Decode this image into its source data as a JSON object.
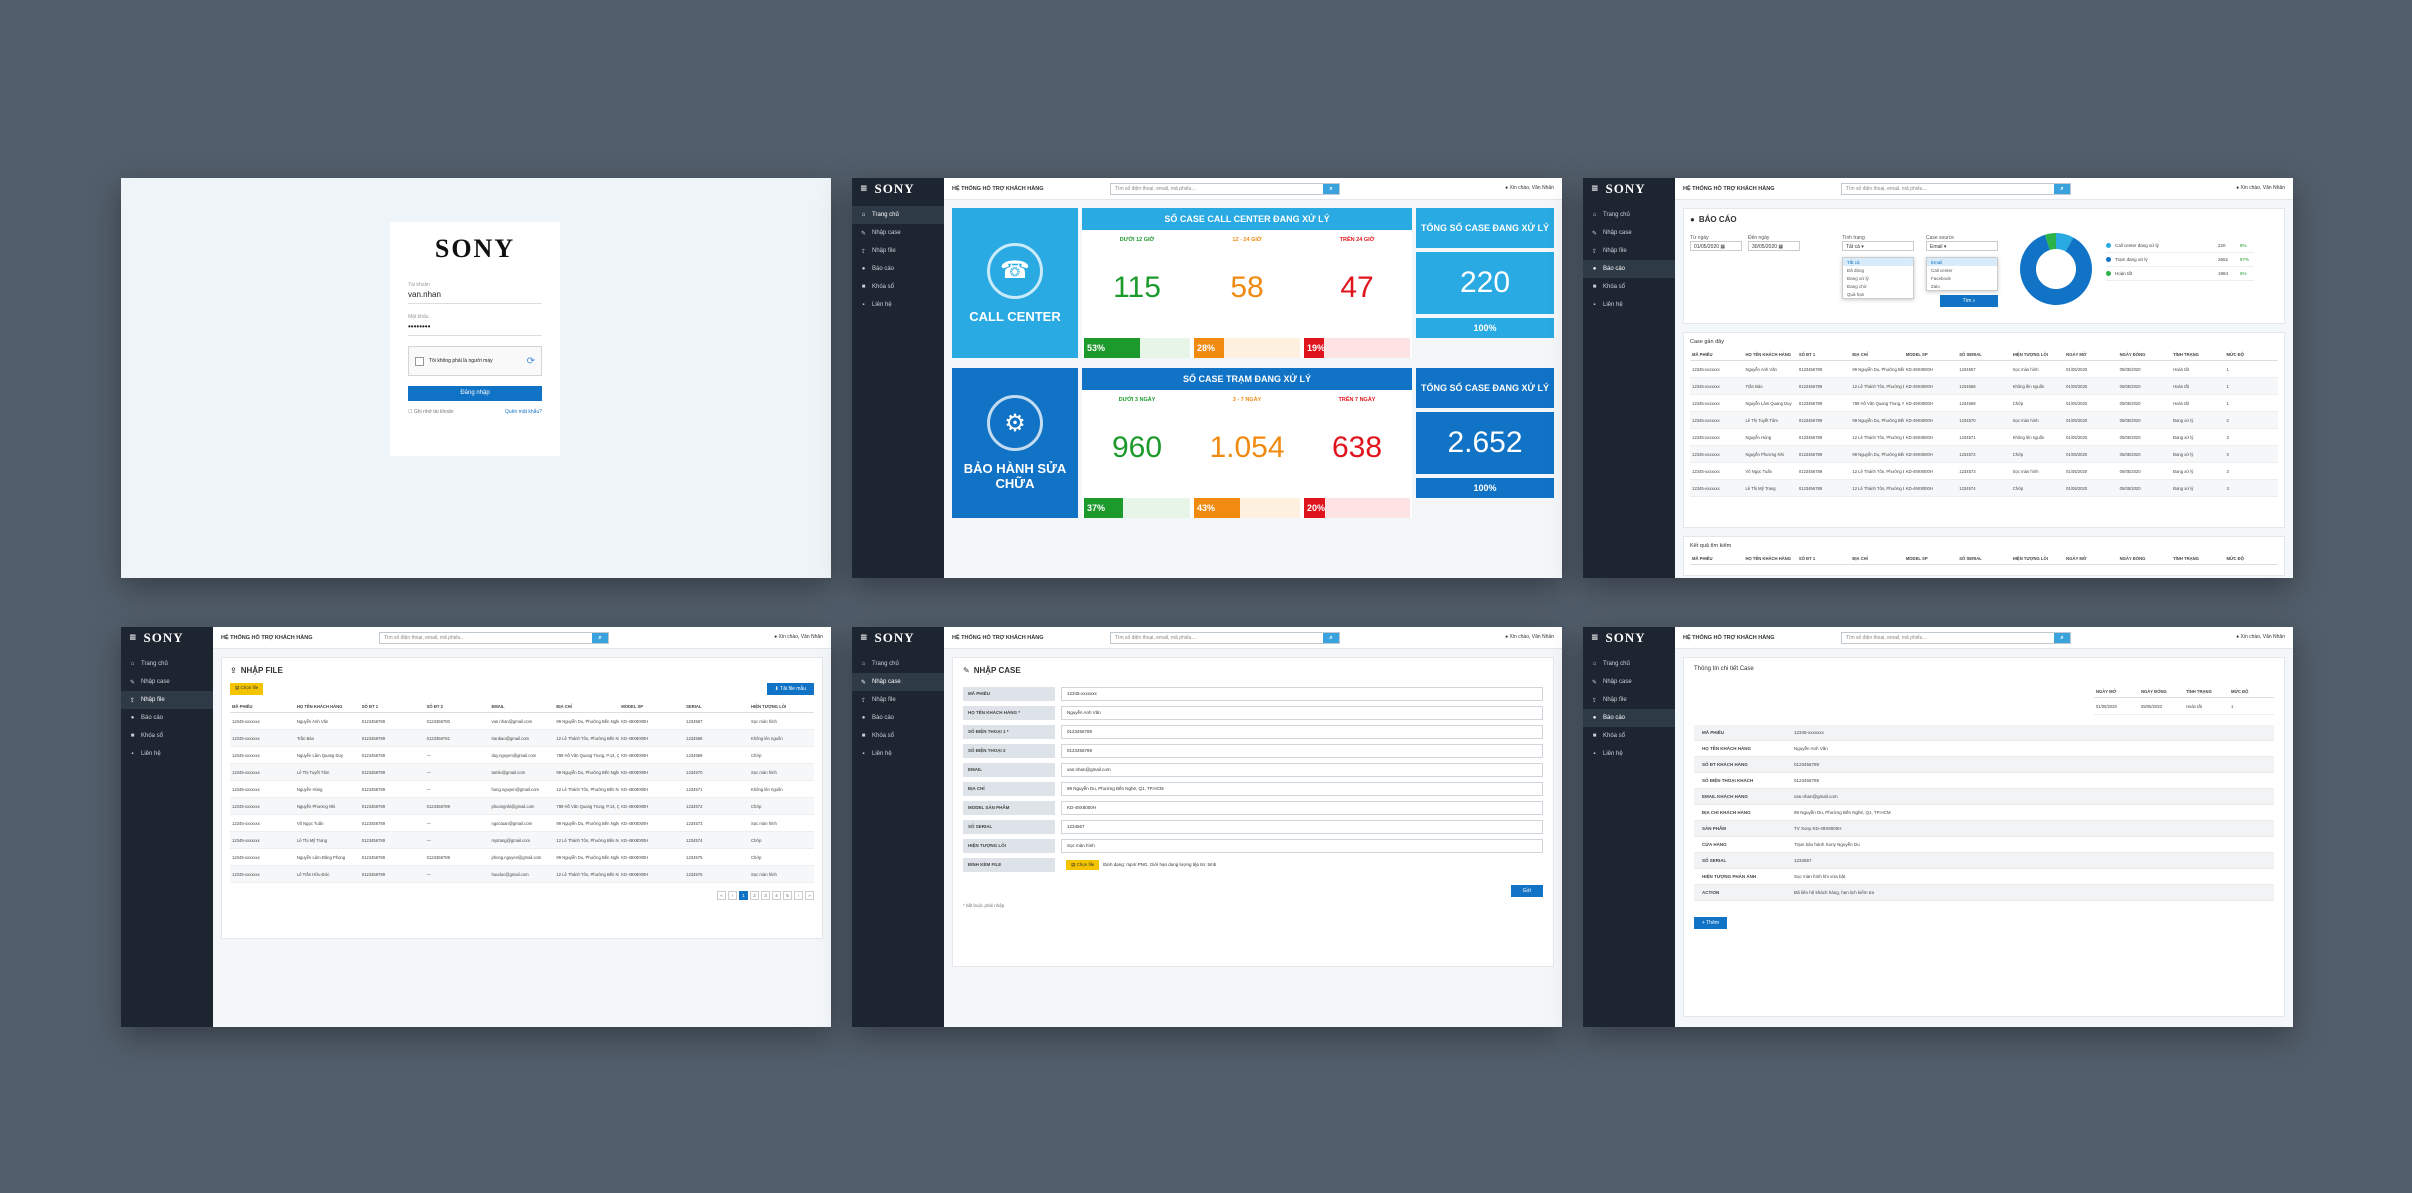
{
  "app": {
    "brand": "SONY",
    "system_title": "HỆ THỐNG HỖ TRỢ KHÁCH HÀNG",
    "search_placeholder": "Tìm số điện thoại, email, mã phiếu...",
    "user": "Xin chào, Văn Nhân",
    "nav": [
      "Trang chủ",
      "Nhập case",
      "Nhập file",
      "Báo cáo",
      "Khóa sổ",
      "Liên hệ"
    ],
    "icons": {
      "search": "search-icon",
      "user": "user-icon",
      "menu": "hamburger-icon"
    }
  },
  "login": {
    "logo": "SONY",
    "username_label": "Tài khoản",
    "username_value": "van.nhan",
    "password_label": "Mật khẩu",
    "password_value": "••••••••",
    "captcha_label": "Tôi không phải là người máy",
    "submit": "Đăng nhập",
    "remember": "Ghi nhớ tài khoản",
    "forgot": "Quên mật khẩu?"
  },
  "dashboard": {
    "call_center": {
      "label": "CALL CENTER",
      "header": "SỐ CASE CALL CENTER ĐANG XỬ LÝ",
      "columns": [
        {
          "label": "DƯỚI 12 GIỜ",
          "value": "115",
          "percent": "53%",
          "ratio": 0.53
        },
        {
          "label": "12 - 24 GIỜ",
          "value": "58",
          "percent": "28%",
          "ratio": 0.28
        },
        {
          "label": "TRÊN 24 GIỜ",
          "value": "47",
          "percent": "19%",
          "ratio": 0.19
        }
      ],
      "total_label": "TỔNG SỐ CASE ĐANG XỬ LÝ",
      "total": "220",
      "total_percent": "100%"
    },
    "warranty": {
      "label": "BẢO HÀNH SỬA CHỮA",
      "header": "SỐ CASE TRẠM ĐANG XỬ LÝ",
      "columns": [
        {
          "label": "DƯỚI 3 NGÀY",
          "value": "960",
          "percent": "37%",
          "ratio": 0.37
        },
        {
          "label": "3 - 7 NGÀY",
          "value": "1.054",
          "percent": "43%",
          "ratio": 0.43
        },
        {
          "label": "TRÊN 7 NGÀY",
          "value": "638",
          "percent": "20%",
          "ratio": 0.2
        }
      ],
      "total_label": "TỔNG SỐ CASE ĐANG XỬ LÝ",
      "total": "2.652",
      "total_percent": "100%"
    }
  },
  "report": {
    "title": "BÁO CÁO",
    "from_label": "Từ ngày",
    "from_value": "01/05/2020",
    "to_label": "Đến ngày",
    "to_value": "30/05/2020",
    "status_label": "Tình trạng",
    "status_value": "Tất cả",
    "status_options": [
      "Tất cả",
      "Đã đóng",
      "Đang xử lý",
      "Đang chờ",
      "Quá hạn"
    ],
    "source_label": "Case source",
    "source_value": "Email",
    "source_options": [
      "Email",
      "Call center",
      "Facebook",
      "Zalo"
    ],
    "search_button": "Tìm",
    "chart": {
      "type": "donut",
      "items": [
        {
          "name": "Call center đang xử lý",
          "value": "220",
          "percent": "8%",
          "color": "#2aaae2"
        },
        {
          "name": "Trạm đang xử lý",
          "value": "2652",
          "percent": "87%",
          "color": "#1173c5"
        },
        {
          "name": "Hoàn tất",
          "value": "1984",
          "percent": "5%",
          "color": "#2ab24b"
        }
      ]
    },
    "recent_title": "Case gần đây",
    "columns": [
      "MÃ PHIẾU",
      "HỌ TÊN KHÁCH HÀNG",
      "SỐ ĐT 1",
      "ĐỊA CHỈ",
      "MODEL SP",
      "SỐ SERIAL",
      "HIỆN TƯỢNG LỖI",
      "NGÀY MỞ",
      "NGÀY ĐÓNG",
      "TÌNH TRẠNG",
      "MỨC ĐỘ"
    ],
    "rows": [
      [
        "12345-xxxxxxx",
        "Nguyễn Anh Văn",
        "0123456789",
        "99 Nguyễn Du, Phường Bến Nghé, Q1, TP.HCM",
        "KD-49X8000H",
        "1234567",
        "Sọc màn hình",
        "01/05/2020",
        "05/05/2020",
        "Hoàn tất",
        "1"
      ],
      [
        "12345-xxxxxxx",
        "Trần Bảo",
        "0123456789",
        "12 Lê Thánh Tôn, Phường Bến Nghé, Q1, TP.HCM",
        "KD-49X8000H",
        "1234568",
        "Không lên nguồn",
        "01/05/2020",
        "05/05/2020",
        "Hoàn tất",
        "1"
      ],
      [
        "12345-xxxxxxx",
        "Nguyễn Lâm Quang Duy",
        "0123456789",
        "789 Hồ Văn Quang Trung, P.14, Quận Gò Vấp, TP.HCM",
        "KD-49X8000H",
        "1234569",
        "Chớp",
        "01/05/2020",
        "05/05/2020",
        "Hoàn tất",
        "1"
      ],
      [
        "12345-xxxxxxx",
        "Lê Thị Tuyết Tâm",
        "0123456789",
        "99 Nguyễn Du, Phường Bến Nghé, Q1, TP.HCM",
        "KD-49X8000H",
        "1234570",
        "Sọc màn hình",
        "01/05/2020",
        "05/05/2020",
        "Đang xử lý",
        "2"
      ],
      [
        "12345-xxxxxxx",
        "Nguyễn Hùng",
        "0123456789",
        "12 Lê Thánh Tôn, Phường Bến Nghé, Q1, TP.HCM",
        "KD-49X8000H",
        "1234571",
        "Không lên nguồn",
        "01/05/2020",
        "05/05/2020",
        "Đang xử lý",
        "3"
      ],
      [
        "12345-xxxxxxx",
        "Nguyễn Phương Nhi",
        "0123456789",
        "99 Nguyễn Du, Phường Bến Nghé, Q1, TP.HCM",
        "KD-49X8000H",
        "1234572",
        "Chớp",
        "01/05/2020",
        "05/05/2020",
        "Đang xử lý",
        "3"
      ],
      [
        "12345-xxxxxxx",
        "Võ Ngọc Tuấn",
        "0123456789",
        "12 Lê Thánh Tôn, Phường Bến Nghé, Q1, TP.HCM",
        "KD-49X8000H",
        "1234573",
        "Sọc màn hình",
        "01/05/2020",
        "05/05/2020",
        "Đang xử lý",
        "3"
      ],
      [
        "12345-xxxxxxx",
        "Lê Thị Mỹ Trang",
        "0123456789",
        "12 Lê Thánh Tôn, Phường Bến Nghé, Q1, TP.HCM",
        "KD-49X8000H",
        "1234574",
        "Chớp",
        "01/05/2020",
        "05/05/2020",
        "Đang xử lý",
        "3"
      ]
    ],
    "search_results_title": "Kết quả tìm kiếm"
  },
  "import_file": {
    "title": "NHẬP FILE",
    "choose_file": "Chọn file",
    "download_template": "Tải file mẫu",
    "columns": [
      "MÃ PHIẾU",
      "HỌ TÊN KHÁCH HÀNG",
      "SỐ ĐT 1",
      "SỐ ĐT 2",
      "EMAIL",
      "ĐỊA CHỈ",
      "MODEL SP",
      "SERIAL",
      "HIỆN TƯỢNG LỖI"
    ],
    "rows": [
      [
        "12345-xxxxxxx",
        "Nguyễn Anh Văn",
        "0123456789",
        "0123456780",
        "van.nhan@gmail.com",
        "99 Nguyễn Du, Phường Bến Nghé, Q1, TP.HCM",
        "KD-49X8000H",
        "1234567",
        "Sọc màn hình"
      ],
      [
        "12345-xxxxxxx",
        "Trần Bảo",
        "0123456789",
        "0123456781",
        "tranbao@gmail.com",
        "12 Lê Thánh Tôn, Phường Bến Nghé, Q1, TP.HCM",
        "KD-49X8000H",
        "1234568",
        "Không lên nguồn"
      ],
      [
        "12345-xxxxxxx",
        "Nguyễn Lâm Quang Duy",
        "0123456789",
        "",
        "duy.nguyen@gmail.com",
        "789 Hồ Văn Quang Trung, P.14, Quận Gò Vấp, TP.HCM",
        "KD-49X8000H",
        "1234569",
        "Chớp"
      ],
      [
        "12345-xxxxxxx",
        "Lê Thị Tuyết Tâm",
        "0123456789",
        "",
        "tamle@gmail.com",
        "99 Nguyễn Du, Phường Bến Nghé, Q1, TP.HCM",
        "KD-49X8000H",
        "1234570",
        "Sọc màn hình"
      ],
      [
        "12345-xxxxxxx",
        "Nguyễn Hùng",
        "0123456789",
        "",
        "hung.nguyen@gmail.com",
        "12 Lê Thánh Tôn, Phường Bến Nghé, Q1, TP.HCM",
        "KD-49X8000H",
        "1234571",
        "Không lên nguồn"
      ],
      [
        "12345-xxxxxxx",
        "Nguyễn Phương Nhi",
        "0123456789",
        "0123456789",
        "phuongnhi@gmail.com",
        "789 Hồ Văn Quang Trung, P.14, Quận Gò Vấp, TP.HCM",
        "KD-49X8000H",
        "1234572",
        "Chớp"
      ],
      [
        "12345-xxxxxxx",
        "Võ Ngọc Tuấn",
        "0123456789",
        "",
        "ngoctuan@gmail.com",
        "99 Nguyễn Du, Phường Bến Nghé, Q1, TP.HCM",
        "KD-49X8000H",
        "1234573",
        "Sọc màn hình"
      ],
      [
        "12345-xxxxxxx",
        "Lê Thị Mỹ Trang",
        "0123456789",
        "",
        "mytrang@gmail.com",
        "12 Lê Thánh Tôn, Phường Bến Nghé, Q1, TP.HCM",
        "KD-49X8000H",
        "1234574",
        "Chớp"
      ],
      [
        "12345-xxxxxxx",
        "Nguyễn Lâm Đăng Phong",
        "0123456789",
        "0123456789",
        "phong.nguyen@gmail.com",
        "99 Nguyễn Du, Phường Bến Nghé, Q1, TP.HCM",
        "KD-49X8000H",
        "1234575",
        "Chớp"
      ],
      [
        "12345-xxxxxxx",
        "Lê Trần Hữu Đức",
        "0123456789",
        "",
        "huuduc@gmail.com",
        "12 Lê Thánh Tôn, Phường Bến Nghé, Q1, TP.HCM",
        "KD-49X8000H",
        "1234576",
        "Sọc màn hình"
      ]
    ],
    "pages": [
      "«",
      "‹",
      "1",
      "2",
      "3",
      "4",
      "5",
      "›",
      "»"
    ]
  },
  "new_case": {
    "title": "NHẬP CASE",
    "fields": [
      {
        "label": "MÃ PHIẾU",
        "value": "12345-xxxxxxx"
      },
      {
        "label": "HỌ TÊN KHÁCH HÀNG *",
        "value": "Nguyễn Anh Văn"
      },
      {
        "label": "SỐ ĐIỆN THOẠI 1 *",
        "value": "0123456789"
      },
      {
        "label": "SỐ ĐIỆN THOẠI 2",
        "value": "0123456789"
      },
      {
        "label": "EMAIL",
        "value": "van.nhan@gmail.com"
      },
      {
        "label": "ĐỊA CHỈ",
        "value": "99 Nguyễn Du, Phường Bến Nghé, Q1, TP.HCM"
      },
      {
        "label": "MODEL SẢN PHẨM",
        "value": "KD-49X8000H"
      },
      {
        "label": "SỐ SERIAL",
        "value": "1234567"
      },
      {
        "label": "HIỆN TƯỢNG LỖI",
        "value": "Sọc màn hình"
      }
    ],
    "attach_label": "ĐÍNH KÈM FILE",
    "attach_button": "Chọn file",
    "attach_hint": "Định dạng: mp4/.PNG. Giới hạn dung lượng tệp tin: 5mb",
    "submit": "Gửi",
    "required_note": "* bắt buộc phải nhập"
  },
  "case_detail": {
    "title": "Thông tin chi tiết Case",
    "mini_columns": [
      "NGÀY MỞ",
      "NGÀY ĐÓNG",
      "TÌNH TRẠNG",
      "MỨC ĐỘ"
    ],
    "mini_row": [
      "01/05/2020",
      "05/05/2020",
      "Hoàn tất",
      "1"
    ],
    "items": [
      {
        "label": "MÃ PHIẾU",
        "value": "12345-xxxxxxx"
      },
      {
        "label": "HỌ TÊN KHÁCH HÀNG",
        "value": "Nguyễn Anh Văn"
      },
      {
        "label": "SỐ ĐT KHÁCH HÀNG",
        "value": "0123456789"
      },
      {
        "label": "SỐ ĐIỆN THOẠI KHÁCH",
        "value": "0123456789"
      },
      {
        "label": "EMAIL KHÁCH HÀNG",
        "value": "van.nhan@gmail.com"
      },
      {
        "label": "ĐỊA CHỈ KHÁCH HÀNG",
        "value": "99 Nguyễn Du, Phường Bến Nghé, Q1, TP.HCM"
      },
      {
        "label": "SẢN PHẨM",
        "value": "TV Sony KD-49X8000H"
      },
      {
        "label": "CỬA HÀNG",
        "value": "Trạm bảo hành Sony Nguyễn Du"
      },
      {
        "label": "SỐ SERIAL",
        "value": "1234567"
      },
      {
        "label": "HIỆN TƯỢNG PHẢN ÁNH",
        "value": "Sọc màn hình khi vừa bật"
      },
      {
        "label": "ACTION",
        "value": "Đã liên hệ khách hàng, hẹn lịch kiểm tra"
      }
    ],
    "add_button": "Thêm"
  }
}
